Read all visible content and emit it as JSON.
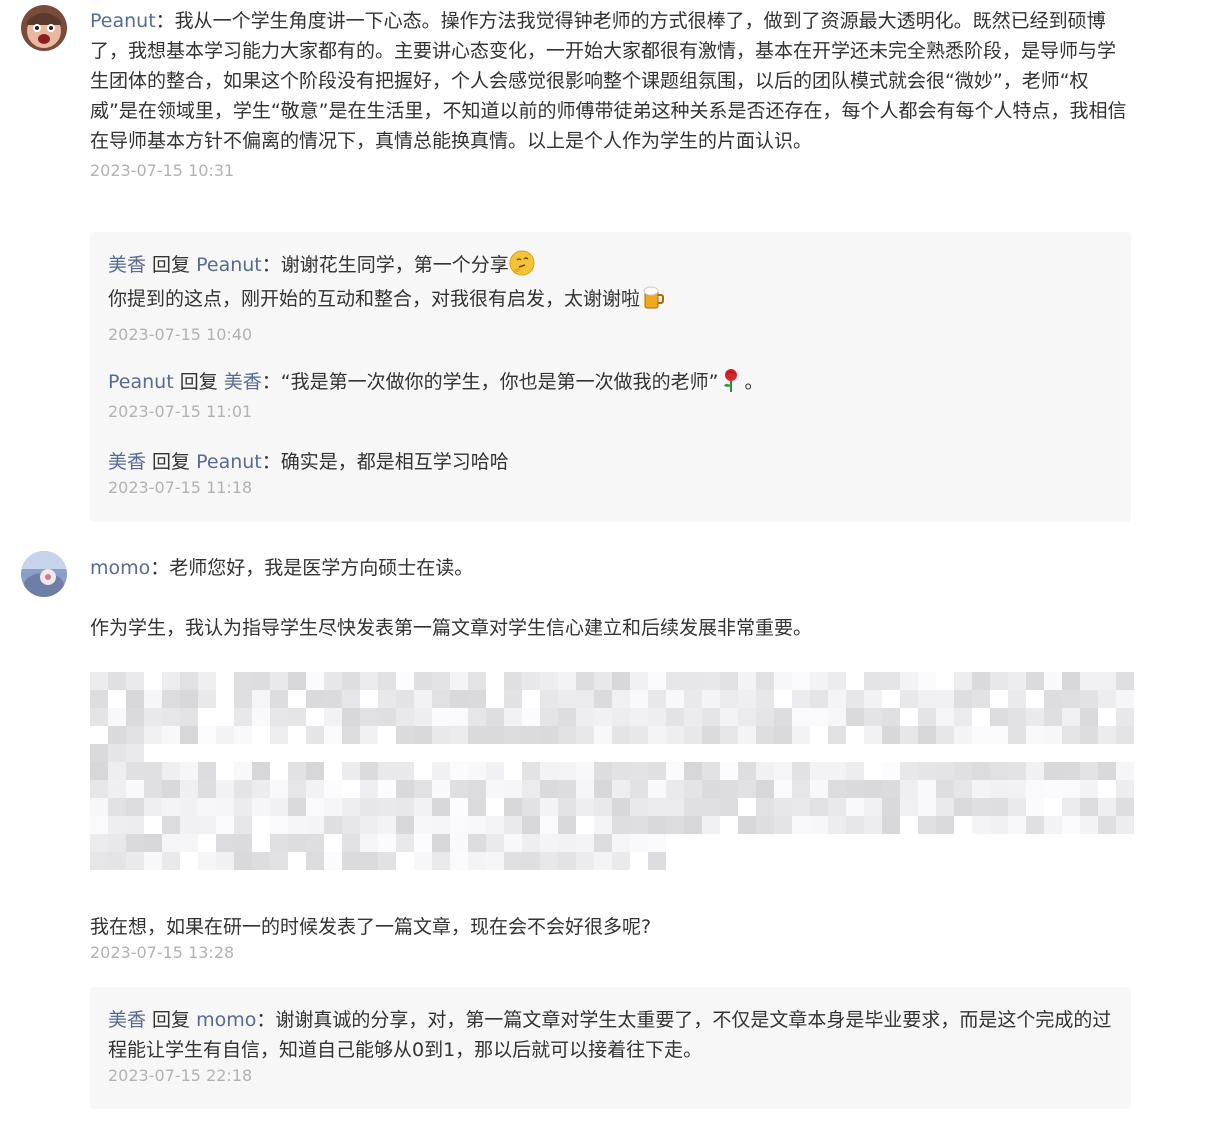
{
  "comments": [
    {
      "author": "Peanut",
      "colon": "：",
      "content": "我从一个学生角度讲一下心态。操作方法我觉得钟老师的方式很棒了，做到了资源最大透明化。既然已经到硕博了，我想基本学习能力大家都有的。主要讲心态变化，一开始大家都很有激情，基本在开学还未完全熟悉阶段，是导师与学生团体的整合，如果这个阶段没有把握好，个人会感觉很影响整个课题组氛围，以后的团队模式就会很“微妙”，老师“权威”是在领域里，学生“敬意”是在生活里，不知道以前的师傅带徒弟这种关系是否还存在，每个人都会有每个人特点，我相信在导师基本方针不偏离的情况下，真情总能换真情。以上是个人作为学生的片面认识。",
      "time": "2023-07-15 10:31",
      "replies": [
        {
          "from": "美香",
          "reply_word": " 回复 ",
          "to": "Peanut",
          "colon": "：",
          "line1": "谢谢花生同学，第一个分享",
          "line2": "你提到的这点，刚开始的互动和整合，对我很有启发，太谢谢啦",
          "time": "2023-07-15 10:40"
        },
        {
          "from": "Peanut",
          "reply_word": " 回复 ",
          "to": "美香",
          "colon": "：",
          "line1": "“我是第一次做你的学生，你也是第一次做我的老师”",
          "line1_tail": "。",
          "time": "2023-07-15 11:01"
        },
        {
          "from": "美香",
          "reply_word": " 回复 ",
          "to": "Peanut",
          "colon": "：",
          "line1": "确实是，都是相互学习哈哈",
          "time": "2023-07-15 11:18"
        }
      ]
    },
    {
      "author": "momo",
      "colon": "：",
      "p1": "老师您好，我是医学方向硕士在读。",
      "p2": "作为学生，我认为指导学生尽快发表第一篇文章对学生信心建立和后续发展非常重要。",
      "p3": "我在想，如果在研一的时候发表了一篇文章，现在会不会好很多呢?",
      "time": "2023-07-15 13:28",
      "replies": [
        {
          "from": "美香",
          "reply_word": " 回复 ",
          "to": "momo",
          "colon": "：",
          "line1": "谢谢真诚的分享，对，第一篇文章对学生太重要了，不仅是文章本身是毕业要求，而是这个完成的过程能让学生有自信，知道自己能够从0到1，那以后就可以接着往下走。",
          "time": "2023-07-15 22:18"
        }
      ]
    }
  ],
  "colors": {
    "name": "#576b95",
    "text": "#333333",
    "time": "#b2b2b2",
    "reply_bg": "#f7f7f7"
  },
  "icons": [
    "thinking-face-emoji",
    "beer-mug-emoji",
    "rose-emoji",
    "pixelated-redaction"
  ]
}
